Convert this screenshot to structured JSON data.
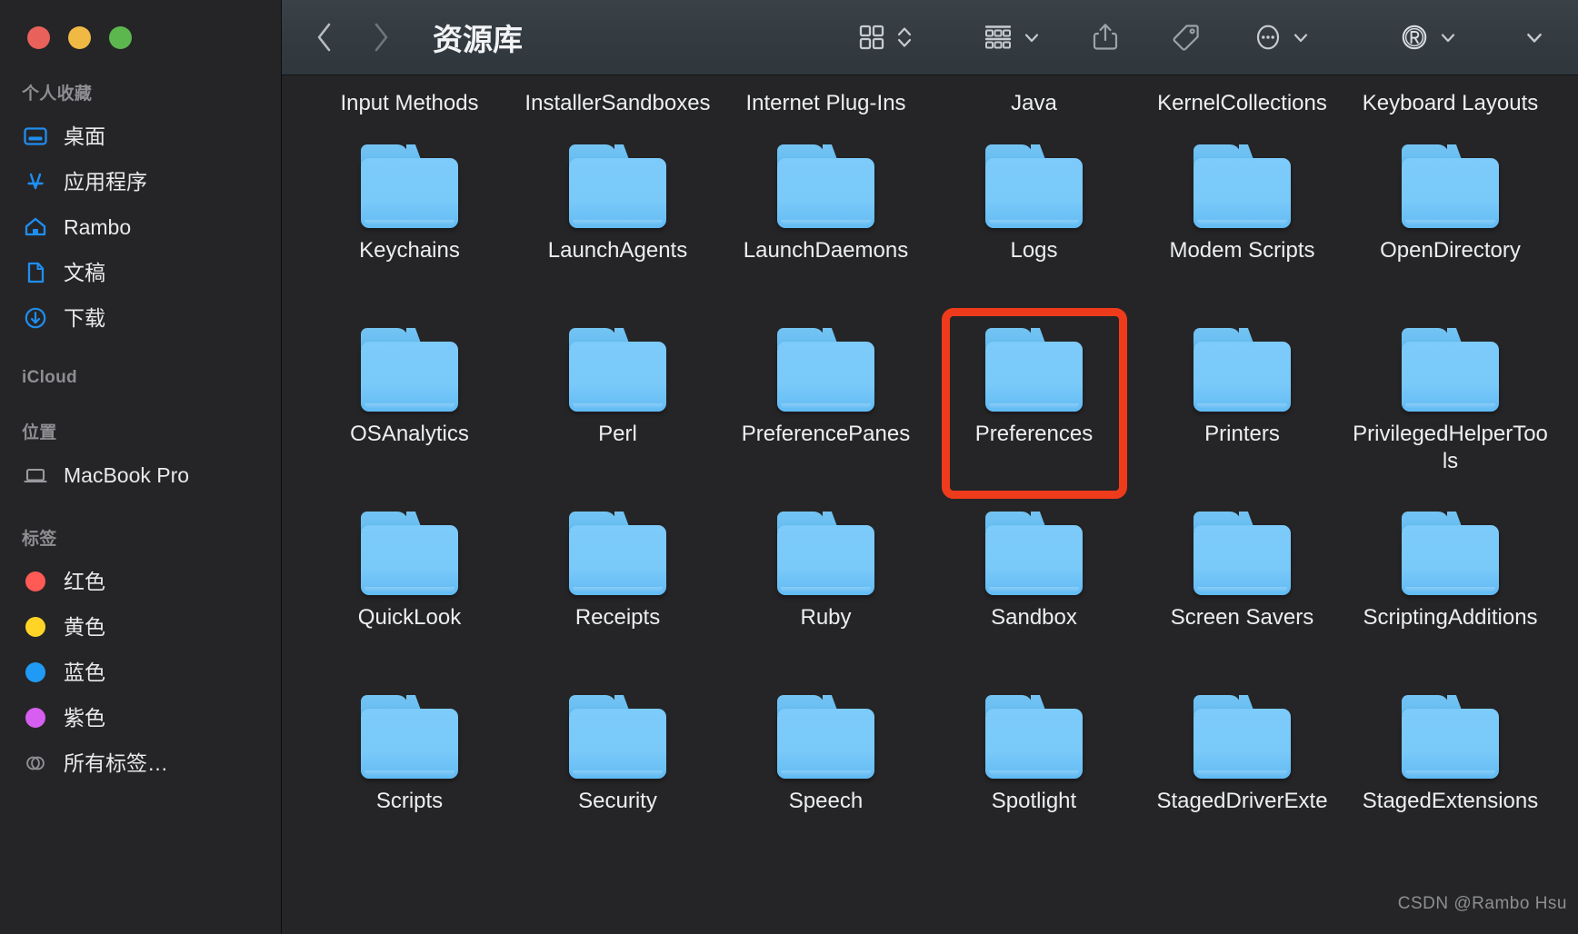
{
  "window": {
    "traffic_lights": [
      {
        "name": "close",
        "color": "#e8615a"
      },
      {
        "name": "minimize",
        "color": "#efb944"
      },
      {
        "name": "maximize",
        "color": "#5cb84e"
      }
    ]
  },
  "sidebar": {
    "sections": [
      {
        "header": "个人收藏",
        "items": [
          {
            "label": "桌面",
            "icon": "desktop-icon"
          },
          {
            "label": "应用程序",
            "icon": "applications-icon"
          },
          {
            "label": "Rambo",
            "icon": "home-icon"
          },
          {
            "label": "文稿",
            "icon": "documents-icon"
          },
          {
            "label": "下载",
            "icon": "downloads-icon"
          }
        ]
      },
      {
        "header": "iCloud",
        "items": []
      },
      {
        "header": "位置",
        "items": [
          {
            "label": "MacBook Pro",
            "icon": "laptop-icon"
          }
        ]
      },
      {
        "header": "标签",
        "items": [
          {
            "label": "红色",
            "icon": "tag-dot-icon",
            "color": "#ff5a55"
          },
          {
            "label": "黄色",
            "icon": "tag-dot-icon",
            "color": "#ffd426"
          },
          {
            "label": "蓝色",
            "icon": "tag-dot-icon",
            "color": "#1f9bf5"
          },
          {
            "label": "紫色",
            "icon": "tag-dot-icon",
            "color": "#d65ef0"
          },
          {
            "label": "所有标签…",
            "icon": "all-tags-icon",
            "color": ""
          }
        ]
      }
    ]
  },
  "toolbar": {
    "back": "‹",
    "forward": "›",
    "title": "资源库",
    "buttons": [
      {
        "name": "view-grid-button",
        "icon": "grid-view-icon",
        "chevron": "updown"
      },
      {
        "name": "group-by-button",
        "icon": "group-list-icon",
        "chevron": "down"
      },
      {
        "name": "share-button",
        "icon": "share-icon",
        "chevron": "none"
      },
      {
        "name": "tag-button",
        "icon": "tag-icon",
        "chevron": "none"
      },
      {
        "name": "more-actions-button",
        "icon": "ellipsis-circle-icon",
        "chevron": "down"
      },
      {
        "name": "account-button",
        "icon": "registered-r-icon",
        "chevron": "down"
      },
      {
        "name": "overflow-button",
        "icon": "chevron-down-icon",
        "chevron": "none"
      }
    ]
  },
  "content": {
    "clipped_top_row": [
      "Input Methods",
      "InstallerSandboxes",
      "Internet Plug-Ins",
      "Java",
      "KernelCollections",
      "Keyboard Layouts"
    ],
    "rows": [
      {
        "items": [
          {
            "label": "Keychains",
            "selected": false
          },
          {
            "label": "LaunchAgents",
            "selected": false
          },
          {
            "label": "LaunchDaemons",
            "selected": false
          },
          {
            "label": "Logs",
            "selected": false
          },
          {
            "label": "Modem Scripts",
            "selected": false
          },
          {
            "label": "OpenDirectory",
            "selected": false
          }
        ]
      },
      {
        "items": [
          {
            "label": "OSAnalytics",
            "selected": false
          },
          {
            "label": "Perl",
            "selected": false
          },
          {
            "label": "PreferencePanes",
            "selected": false
          },
          {
            "label": "Preferences",
            "selected": true
          },
          {
            "label": "Printers",
            "selected": false
          },
          {
            "label": "PrivilegedHelperTools",
            "selected": false
          }
        ]
      },
      {
        "items": [
          {
            "label": "QuickLook",
            "selected": false
          },
          {
            "label": "Receipts",
            "selected": false
          },
          {
            "label": "Ruby",
            "selected": false
          },
          {
            "label": "Sandbox",
            "selected": false
          },
          {
            "label": "Screen Savers",
            "selected": false
          },
          {
            "label": "ScriptingAdditions",
            "selected": false
          }
        ]
      },
      {
        "items": [
          {
            "label": "Scripts",
            "selected": false
          },
          {
            "label": "Security",
            "selected": false
          },
          {
            "label": "Speech",
            "selected": false
          },
          {
            "label": "Spotlight",
            "selected": false
          },
          {
            "label": "StagedDriverExte",
            "selected": false
          },
          {
            "label": "StagedExtensions",
            "selected": false
          }
        ]
      }
    ],
    "highlight_color": "#ee3b1c"
  },
  "watermark": "CSDN @Rambo Hsu"
}
